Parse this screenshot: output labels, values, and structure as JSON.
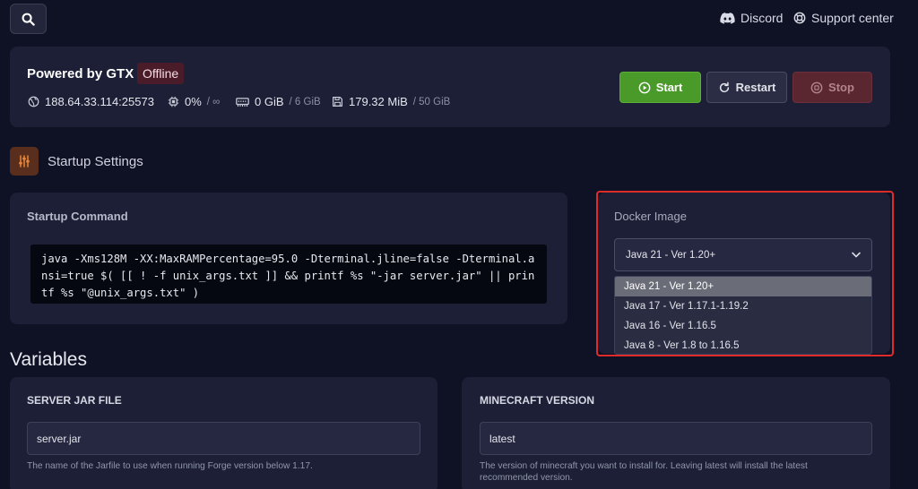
{
  "topbar": {
    "discord_label": "Discord",
    "support_label": "Support center"
  },
  "server": {
    "name": "Powered by GTX",
    "status": "Offline",
    "address": "188.64.33.114:25573",
    "cpu": "0%",
    "cpu_limit": "/ ∞",
    "memory": "0 GiB",
    "memory_limit": "/ 6 GiB",
    "disk": "179.32 MiB",
    "disk_limit": "/ 50 GiB",
    "start_label": "Start",
    "restart_label": "Restart",
    "stop_label": "Stop"
  },
  "startup": {
    "section_title": "Startup Settings",
    "command_label": "Startup Command",
    "command": "java -Xms128M -XX:MaxRAMPercentage=95.0 -Dterminal.jline=false -Dterminal.ansi=true $( [[ ! -f unix_args.txt ]] && printf %s \"-jar server.jar\" || printf %s \"@unix_args.txt\" )"
  },
  "docker": {
    "label": "Docker Image",
    "selected": "Java 21 - Ver 1.20+",
    "options": [
      "Java 21 - Ver 1.20+",
      "Java 17 - Ver 1.17.1-1.19.2",
      "Java 16 - Ver 1.16.5",
      "Java 8 - Ver 1.8 to 1.16.5"
    ]
  },
  "variables": {
    "title": "Variables",
    "items": [
      {
        "title": "SERVER JAR FILE",
        "value": "server.jar",
        "description": "The name of the Jarfile to use when running Forge version below 1.17."
      },
      {
        "title": "MINECRAFT VERSION",
        "value": "latest",
        "description": "The version of minecraft you want to install for. Leaving latest will install the latest recommended version."
      }
    ]
  },
  "colors": {
    "background": "#0f1225",
    "card": "#1c1f35",
    "start": "#4a9a2a",
    "stop": "#5a2630",
    "highlight": "#e02b2b",
    "settings_icon": "#e8873a"
  }
}
